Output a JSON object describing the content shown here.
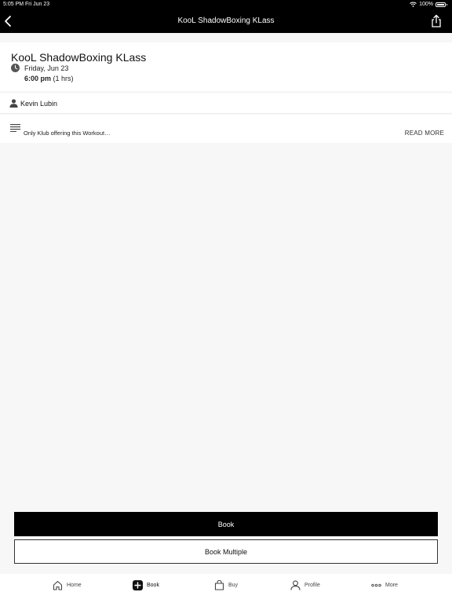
{
  "status_bar": {
    "time": "5:05 PM Fri Jun 23",
    "battery": "100%"
  },
  "nav": {
    "title": "KooL ShadowBoxing KLass"
  },
  "event": {
    "title": "KooL ShadowBoxing KLass",
    "date": "Friday, Jun 23",
    "time": "6:00 pm",
    "duration": "(1 hrs)"
  },
  "instructor": {
    "name": "Kevin Lubin"
  },
  "description": {
    "text": "Only Klub offering this Workout…",
    "read_more": "READ MORE"
  },
  "actions": {
    "book": "Book",
    "book_multiple": "Book Multiple"
  },
  "tabs": [
    {
      "label": "Home",
      "icon": "home-icon"
    },
    {
      "label": "Book",
      "icon": "plus-square-icon"
    },
    {
      "label": "Buy",
      "icon": "shopping-bag-icon"
    },
    {
      "label": "Profile",
      "icon": "person-icon"
    },
    {
      "label": "More",
      "icon": "ellipsis-icon"
    }
  ]
}
